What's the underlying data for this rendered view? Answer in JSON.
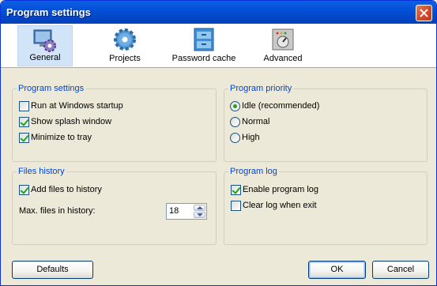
{
  "window": {
    "title": "Program settings"
  },
  "tabs": [
    {
      "label": "General",
      "icon": "gear-monitor-icon",
      "active": true
    },
    {
      "label": "Projects",
      "icon": "gear-icon",
      "active": false
    },
    {
      "label": "Password cache",
      "icon": "cabinet-icon",
      "active": false
    },
    {
      "label": "Advanced",
      "icon": "control-panel-icon",
      "active": false
    }
  ],
  "program_settings": {
    "title": "Program settings",
    "options": [
      {
        "label": "Run at Windows startup",
        "checked": false
      },
      {
        "label": "Show splash window",
        "checked": true
      },
      {
        "label": "Minimize to tray",
        "checked": true
      }
    ]
  },
  "program_priority": {
    "title": "Program priority",
    "options": [
      {
        "label": "Idle (recommended)",
        "selected": true
      },
      {
        "label": "Normal",
        "selected": false
      },
      {
        "label": "High",
        "selected": false
      }
    ]
  },
  "files_history": {
    "title": "Files history",
    "add_label": "Add files to history",
    "add_checked": true,
    "max_label": "Max. files in history:",
    "max_value": "18"
  },
  "program_log": {
    "title": "Program log",
    "options": [
      {
        "label": "Enable program log",
        "checked": true
      },
      {
        "label": "Clear log when exit",
        "checked": false
      }
    ]
  },
  "buttons": {
    "defaults": "Defaults",
    "ok": "OK",
    "cancel": "Cancel"
  },
  "colors": {
    "group_title": "#0046D5",
    "titlebar": "#0450D8",
    "check": "#21A121"
  }
}
